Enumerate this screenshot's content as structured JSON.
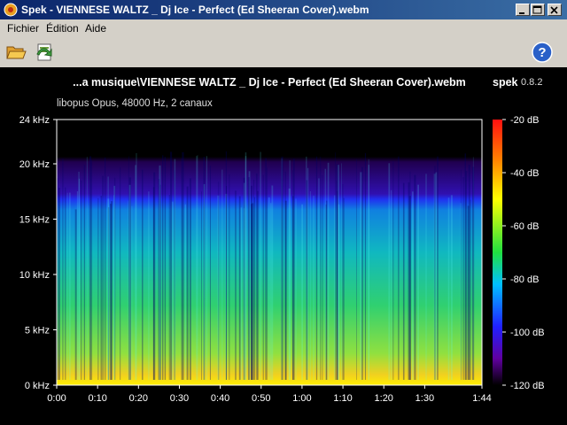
{
  "window": {
    "title": "Spek - VIENNESE WALTZ _ Dj Ice - Perfect (Ed Sheeran Cover).webm",
    "controls": [
      "minimize-button",
      "maximize-button",
      "close-button"
    ]
  },
  "menu": {
    "items": [
      {
        "label": "Fichier"
      },
      {
        "label": "Édition"
      },
      {
        "label": "Aide"
      }
    ]
  },
  "toolbar": {
    "icons": [
      "open-folder-icon",
      "save-export-icon",
      "help-icon"
    ]
  },
  "spectrogram": {
    "file_title": "...a musique\\VIENNESE WALTZ _ Dj Ice - Perfect (Ed Sheeran Cover).webm",
    "app_name": "spek",
    "app_version": "0.8.2",
    "stream_info": "libopus Opus, 48000 Hz, 2 canaux",
    "freq_ticks": [
      "0 kHz",
      "5 kHz",
      "10 kHz",
      "15 kHz",
      "20 kHz",
      "24 kHz"
    ],
    "time_ticks": [
      "0:00",
      "0:10",
      "0:20",
      "0:30",
      "0:40",
      "0:50",
      "1:00",
      "1:10",
      "1:20",
      "1:30",
      "1:44"
    ],
    "db_ticks": [
      "-20 dB",
      "-40 dB",
      "-60 dB",
      "-80 dB",
      "-100 dB",
      "-120 dB"
    ],
    "colors": {
      "background": "#000000",
      "high": "#ffff00",
      "mid": "#00cc66",
      "low": "#2020ff",
      "floor": "#000040"
    }
  }
}
